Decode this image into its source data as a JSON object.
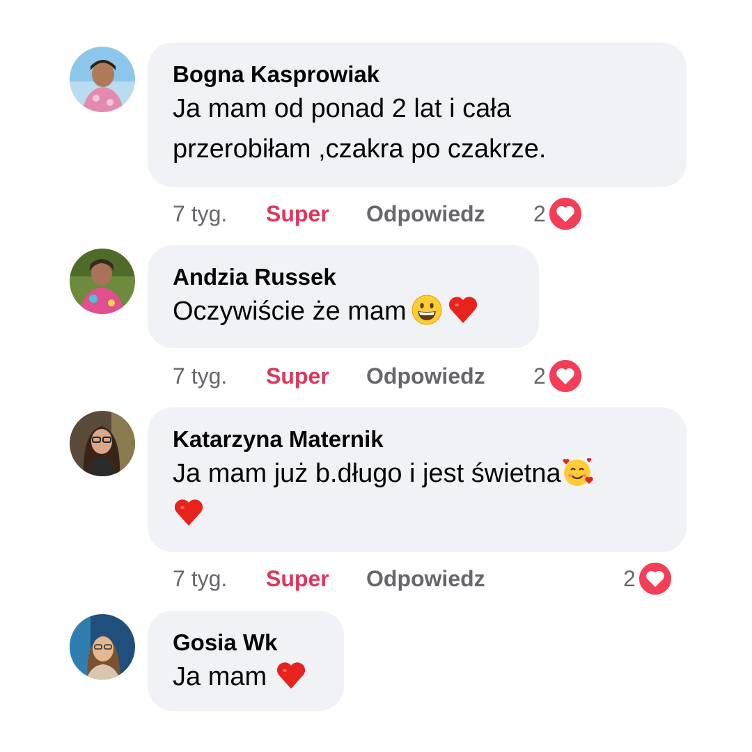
{
  "comments": [
    {
      "author": "Bogna Kasprowiak",
      "text_lines": [
        "Ja mam od ponad 2 lat i cała",
        "przerobiłam ,czakra po czakrze."
      ],
      "time": "7 tyg.",
      "like_label": "Super",
      "reply_label": "Odpowiedz",
      "reaction_count": "2",
      "reaction_icon": "love-icon"
    },
    {
      "author": "Andzia Russek",
      "text": "Oczywiście że mam",
      "emojis": [
        "grinning-face-icon",
        "red-heart-icon"
      ],
      "time": "7 tyg.",
      "like_label": "Super",
      "reply_label": "Odpowiedz",
      "reaction_count": "2",
      "reaction_icon": "love-icon"
    },
    {
      "author": "Katarzyna Maternik",
      "text_lines": [
        "Ja mam już b.długo i jest świetna"
      ],
      "emojis": [
        "smiling-face-with-hearts-icon",
        "red-heart-icon"
      ],
      "time": "7 tyg.",
      "like_label": "Super",
      "reply_label": "Odpowiedz",
      "reaction_count": "2",
      "reaction_icon": "love-icon"
    },
    {
      "author": "Gosia Wk",
      "text": "Ja mam",
      "emojis": [
        "red-heart-icon"
      ]
    }
  ],
  "colors": {
    "bubble": "#f0f2f5",
    "like_active": "#e0345a",
    "meta_text": "#65676b",
    "love_reaction": "#f33e58"
  }
}
